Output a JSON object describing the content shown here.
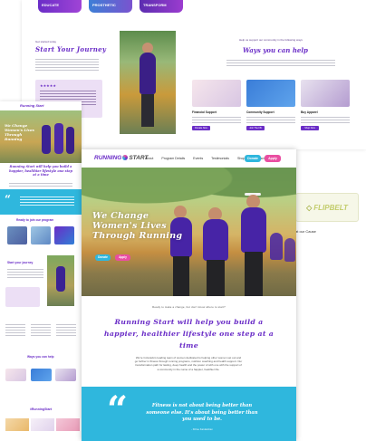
{
  "back_page": {
    "pills": [
      "Educate",
      "Prosthetic",
      "Transform"
    ],
    "start_journey": {
      "eyebrow": "Get started today",
      "title": "Start Your Journey",
      "stars": "★★★★★"
    },
    "ways": {
      "eyebrow": "Help us support our community in the following ways",
      "title": "Ways you can help",
      "cards": [
        {
          "title": "Financial Support",
          "button": "Donate Now"
        },
        {
          "title": "Community Support",
          "button": "Join The FB Group"
        },
        {
          "title": "Buy Apparel",
          "button": "Shop Now"
        }
      ]
    },
    "sponsor": {
      "logo_text": "FLIPBELT",
      "cause_label": "at our Cause"
    }
  },
  "mobile_page": {
    "logo": "Running Start",
    "hero_title": "We Change Women's Lives Through Running",
    "headline": "Running Start will help you build a happier, healthier lifestyle one step at a time",
    "section_programs": "Ready to join our program",
    "section_journey": "Start your journey",
    "section_ways": "Ways you can help",
    "hashtag": "#RunningStart"
  },
  "main_page": {
    "nav": {
      "logo_a": "RUNNING",
      "logo_b": "START",
      "links": [
        "About",
        "Program Details",
        "Events",
        "Testimonials",
        "Shop",
        "Contact"
      ],
      "donate": "Donate",
      "apply": "Apply"
    },
    "hero": {
      "title": "We Change Women's Lives Through Running",
      "donate": "Donate",
      "apply": "Apply"
    },
    "intro": {
      "eyebrow": "Ready to make a change, but don't know where to start?",
      "title": "Running Start will help you build a happier, healthier lifestyle one step at a time",
      "body": "We're Colorado's leading team of women dedicated to helping other women set out and go further in fitness through running programs, nutrition coaching and health support. Our transformation path for lasting, deep health and the power of with one with the support of a community in the name of a happier, healthier life."
    },
    "quote": {
      "text": "Fitness is not about being better than someone else. It's about being better than you used to be.",
      "author": "- Khloe Kardashian"
    }
  },
  "colors": {
    "purple": "#6a2dc7",
    "cyan": "#2fb7dd",
    "pink": "#e94ea1"
  }
}
